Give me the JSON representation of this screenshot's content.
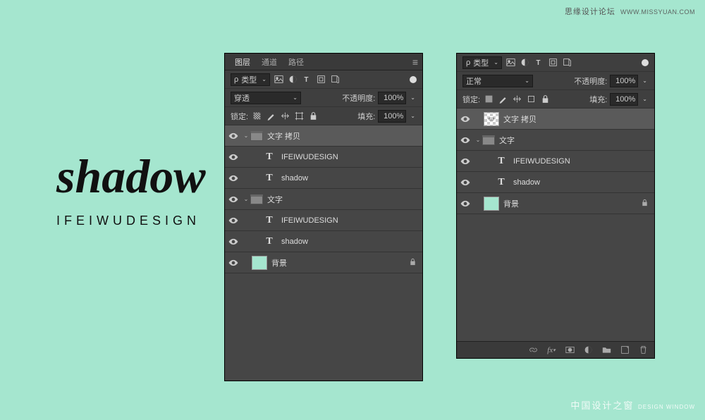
{
  "watermark_top": {
    "cn": "思缘设计论坛",
    "en": "WWW.MISSYUAN.COM"
  },
  "watermark_bottom": {
    "main": "中国设计之窗",
    "sub": "DESIGN WINDOW"
  },
  "preview": {
    "script": "shadow",
    "tag": "IFEIWUDESIGN"
  },
  "common": {
    "opacity_label": "不透明度:",
    "fill_label": "填充:",
    "lock_label": "锁定:",
    "opacity_val": "100%",
    "fill_val": "100%",
    "filter_prefix": "ρ",
    "chevron": "⌄"
  },
  "panel1": {
    "tabs": [
      "图层",
      "通道",
      "路径"
    ],
    "filter_label": "类型",
    "blend": "穿透",
    "layers": [
      {
        "type": "folder",
        "indent": 0,
        "disclose": "⌄",
        "name": "文字 拷贝",
        "selected": true
      },
      {
        "type": "text",
        "indent": 1,
        "name": "IFEIWUDESIGN"
      },
      {
        "type": "text",
        "indent": 1,
        "name": "shadow"
      },
      {
        "type": "folder",
        "indent": 0,
        "disclose": "⌄",
        "name": "文字"
      },
      {
        "type": "text",
        "indent": 1,
        "name": "IFEIWUDESIGN"
      },
      {
        "type": "text",
        "indent": 1,
        "name": "shadow"
      },
      {
        "type": "bg",
        "indent": 0,
        "name": "背景",
        "locked": true
      }
    ]
  },
  "panel2": {
    "filter_label": "类型",
    "blend": "正常",
    "layers": [
      {
        "type": "smart",
        "indent": 0,
        "name": "文字 拷贝",
        "selected": true
      },
      {
        "type": "folder",
        "indent": 0,
        "disclose": "⌄",
        "name": "文字"
      },
      {
        "type": "text",
        "indent": 1,
        "name": "IFEIWUDESIGN"
      },
      {
        "type": "text",
        "indent": 1,
        "name": "shadow"
      },
      {
        "type": "bg",
        "indent": 0,
        "name": "背景",
        "locked": true
      }
    ]
  }
}
